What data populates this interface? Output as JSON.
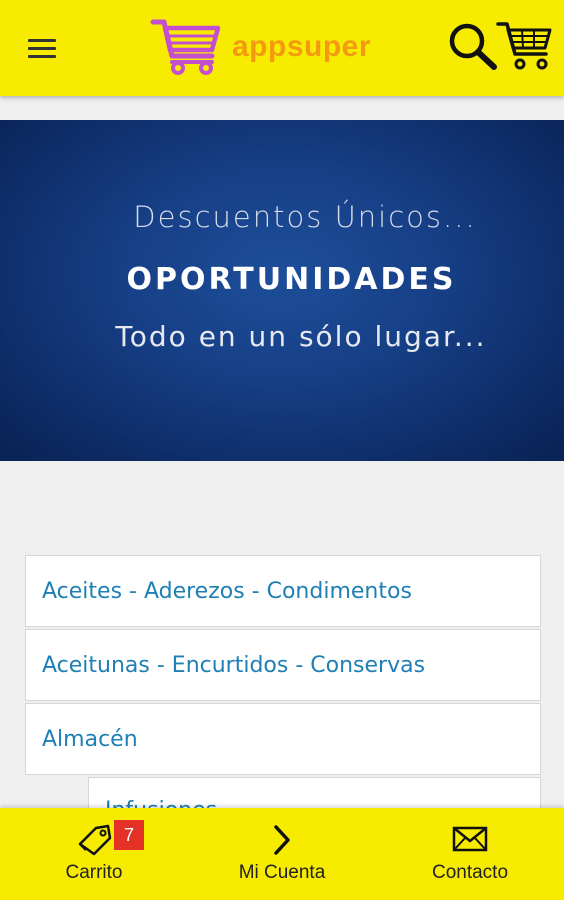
{
  "header": {
    "menu_icon": "hamburger-menu-icon",
    "logo_icon": "shopping-cart-logo-icon",
    "logo_text": "appsuper",
    "search_icon": "magnifier-icon",
    "cart_icon": "shopping-cart-icon"
  },
  "banner": {
    "line1": "Descuentos Únicos...",
    "line2": "OPORTUNIDADES",
    "line3": "Todo en un sólo lugar..."
  },
  "categories": [
    {
      "label": "Aceites - Aderezos - Condimentos"
    },
    {
      "label": "Aceitunas - Encurtidos - Conservas"
    },
    {
      "label": "Almacén"
    }
  ],
  "subcategory": {
    "label": "Infusiones"
  },
  "bottom_nav": {
    "carrito": {
      "label": "Carrito",
      "badge": "7",
      "icon": "tag-icon"
    },
    "cuenta": {
      "label": "Mi Cuenta",
      "icon": "chevron-right-icon"
    },
    "contacto": {
      "label": "Contacto",
      "icon": "envelope-icon"
    }
  },
  "colors": {
    "header_bg": "#f7ec00",
    "logo_accent": "#f39a12",
    "logo_cart": "#c34fd0",
    "link_blue": "#1f7fb5",
    "badge_red": "#e53227",
    "banner_blue": "#163f86"
  }
}
